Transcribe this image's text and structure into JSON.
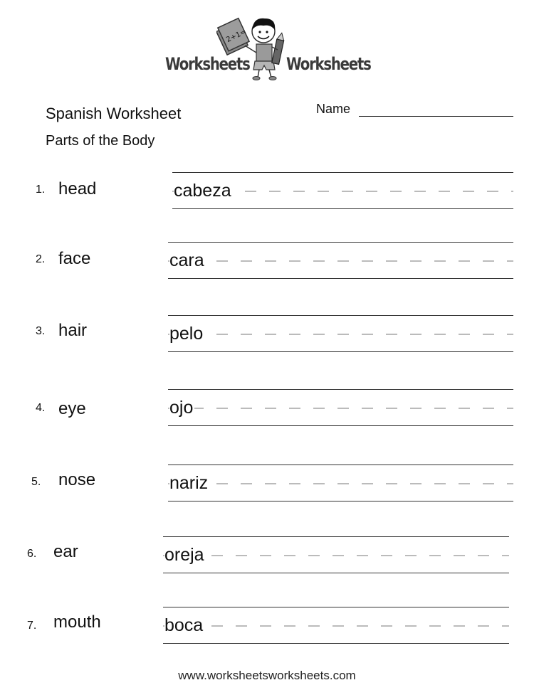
{
  "logo": {
    "left_word": "Worksheets",
    "right_word": "Worksheets",
    "book_text": "2+1="
  },
  "header": {
    "title": "Spanish Worksheet",
    "subtitle": "Parts of the Body",
    "name_label": "Name"
  },
  "items": [
    {
      "number": "1.",
      "english": "head",
      "spanish": "cabeza"
    },
    {
      "number": "2.",
      "english": "face",
      "spanish": "cara"
    },
    {
      "number": "3.",
      "english": "hair",
      "spanish": "pelo"
    },
    {
      "number": "4.",
      "english": "eye",
      "spanish": "ojo"
    },
    {
      "number": "5.",
      "english": "nose",
      "spanish": "nariz"
    },
    {
      "number": "6.",
      "english": "ear",
      "spanish": "oreja"
    },
    {
      "number": "7.",
      "english": "mouth",
      "spanish": "boca"
    }
  ],
  "footer": {
    "url": "www.worksheetsworksheets.com"
  }
}
